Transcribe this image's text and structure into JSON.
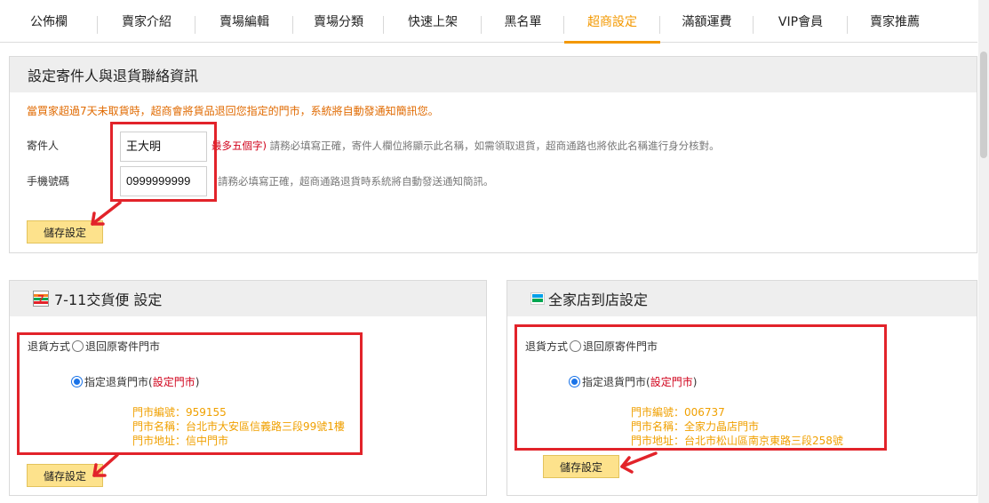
{
  "tabs": [
    {
      "label": "公佈欄"
    },
    {
      "label": "賣家介紹"
    },
    {
      "label": "賣場編輯"
    },
    {
      "label": "賣場分類"
    },
    {
      "label": "快速上架"
    },
    {
      "label": "黑名單"
    },
    {
      "label": "超商設定",
      "active": true
    },
    {
      "label": "滿額運費"
    },
    {
      "label": "VIP會員"
    },
    {
      "label": "賣家推薦"
    }
  ],
  "sender_panel": {
    "title": "設定寄件人與退貨聯絡資訊",
    "notice": "當買家超過7天未取貨時，超商會將貨品退回您指定的門市，系統將自動發通知簡訊您。",
    "sender_label": "寄件人",
    "sender_value": "王大明",
    "sender_hint_red": "最多五個字)",
    "sender_hint": "請務必填寫正確，寄件人欄位將顯示此名稱，如需領取退貨，超商通路也將依此名稱進行身分核對。",
    "phone_label": "手機號碼",
    "phone_value": "0999999999",
    "phone_hint": "請務必填寫正確，超商通路退貨時系統將自動發送通知簡訊。",
    "save_label": "儲存設定"
  },
  "seven_panel": {
    "title": "7-11交貨便 設定",
    "logo_text": "7",
    "return_label": "退貨方式",
    "option_original": "退回原寄件門市",
    "option_specified": "指定退貨門市(",
    "set_store_link": "設定門市",
    "close_paren": ")",
    "store_id": "門市編號：959155",
    "store_name": "門市名稱：台北市大安區信義路三段99號1樓",
    "store_address": "門市地址：信中門市",
    "save_label": "儲存設定"
  },
  "family_panel": {
    "title": "全家店到店設定",
    "return_label": "退貨方式",
    "option_original": "退回原寄件門市",
    "option_specified": "指定退貨門市(",
    "set_store_link": "設定門市",
    "close_paren": ")",
    "store_id": "門市編號：006737",
    "store_name": "門市名稱：全家力晶店門市",
    "store_address": "門市地址：台北市松山區南京東路三段258號",
    "save_label": "儲存設定"
  },
  "colors": {
    "accent": "#f39800",
    "annotation_red": "#e2232a",
    "button_yellow": "#fde28c",
    "store_info": "#f0a000"
  }
}
